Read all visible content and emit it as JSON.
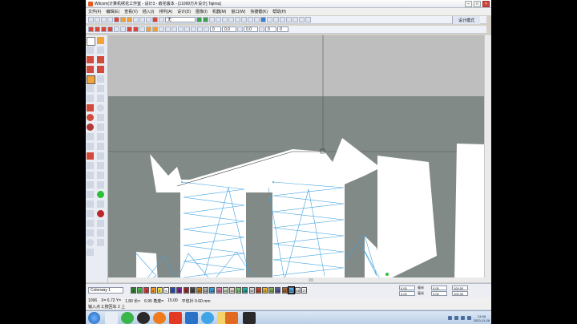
{
  "window": {
    "title": "Wilcom(计算机绣花工作室 - 设计3 - 嵌花版本 - [11099万片设计]         Tajima]",
    "minimize": "–",
    "maximize": "□",
    "close": "×"
  },
  "menu": [
    "文件(F)",
    "编辑(E)",
    "查看(V)",
    "插入(I)",
    "排列(A)",
    "设计(D)",
    "图像(I)",
    "机器(M)",
    "窗口(W)",
    "快捷键(K)",
    "帮助(H)"
  ],
  "toolbar": {
    "font_value": "无",
    "mode_button": "设计模式",
    "num1": "0",
    "num2": "0.0",
    "num3": "0.0",
    "num4": "0",
    "num5": "0"
  },
  "colorbar": {
    "colorway": "Colorway 1",
    "swatches": [
      {
        "label": "1",
        "color": "#2f7f2f"
      },
      {
        "label": "2",
        "color": "#49b549"
      },
      {
        "label": "3",
        "color": "#d63a3a"
      },
      {
        "label": "4",
        "color": "#f29b2a"
      },
      {
        "label": "5",
        "color": "#f0e24a"
      },
      {
        "label": "6",
        "color": "#ffffff"
      },
      {
        "label": "7",
        "color": "#2a4fb0"
      },
      {
        "label": "8",
        "color": "#7a2a8c"
      },
      {
        "label": "9",
        "color": "#9b2a2a"
      },
      {
        "label": "10",
        "color": "#4a4a4a"
      },
      {
        "label": "11",
        "color": "#c7861f"
      },
      {
        "label": "12",
        "color": "#b7b7b7"
      },
      {
        "label": "13",
        "color": "#3aa0d8"
      },
      {
        "label": "14",
        "color": "#e07aa8"
      },
      {
        "label": "15",
        "color": "#cfe6c7"
      },
      {
        "label": "16",
        "color": "#e6dcc7"
      },
      {
        "label": "17",
        "color": "#7dc47d"
      },
      {
        "label": "18",
        "color": "#27b0a8"
      },
      {
        "label": "19",
        "color": "#d8d8d8"
      },
      {
        "label": "20",
        "color": "#c84b2f"
      },
      {
        "label": "21",
        "color": "#e9b73a"
      },
      {
        "label": "22",
        "color": "#8fb25a"
      },
      {
        "label": "23",
        "color": "#5d5d9a"
      },
      {
        "label": "24",
        "color": "#aa6a3a"
      },
      {
        "label": "25",
        "color": "#5ab0e0"
      },
      {
        "label": "26",
        "color": "#e8e8e8"
      },
      {
        "label": "27",
        "color": "#f5f5f5"
      }
    ],
    "fields": {
      "w": "0.00",
      "h": "0.00",
      "w_unit": "毫米",
      "h_unit": "毫米",
      "pct1": "100.00",
      "pct2": "100.00",
      "sx": "0.00",
      "sy": "0.00"
    }
  },
  "status": {
    "stitch": "1096",
    "x": "X=   6.72 Y=",
    "y": "1.80  长=",
    "len": "6.95  角度=",
    "angle": "15.00",
    "stitch_len": "平包针  0.60 mm",
    "hint": "输入点 2,按回车 2  上"
  },
  "taskbar": {
    "clock_time": "13:08",
    "clock_date": "2020-11-06"
  },
  "colors": {
    "canvas_upper": "#bebebe",
    "canvas_lower": "#828a87",
    "stitch_line": "#3fa3e0",
    "shape_fill": "#ffffff"
  }
}
